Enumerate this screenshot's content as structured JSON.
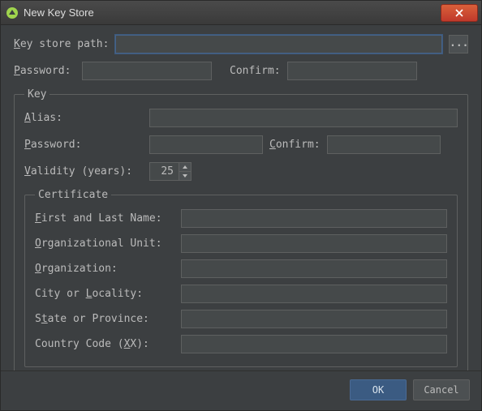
{
  "window": {
    "title": "New Key Store"
  },
  "path": {
    "label_pre": "K",
    "label_rest": "ey store path:",
    "value": "",
    "browse": "..."
  },
  "password": {
    "label_pre": "P",
    "label_rest": "assword:",
    "value": "",
    "confirm_label": "Confirm:",
    "confirm_value": ""
  },
  "key": {
    "legend": "Key",
    "alias": {
      "label_pre": "A",
      "label_rest": "lias:",
      "value": ""
    },
    "password": {
      "label_pre": "P",
      "label_rest": "assword:",
      "value": "",
      "confirm_label_pre": "C",
      "confirm_label_rest": "onfirm:",
      "confirm_value": ""
    },
    "validity": {
      "label_pre": "V",
      "label_rest": "alidity (years):",
      "value": "25"
    },
    "certificate": {
      "legend": "Certificate",
      "first_name": {
        "label_pre": "F",
        "label_rest": "irst and Last Name:",
        "value": ""
      },
      "org_unit": {
        "label_pre": "O",
        "label_rest": "rganizational Unit:",
        "value": ""
      },
      "org": {
        "label_pre": "O",
        "label_rest": "rganization:",
        "value": ""
      },
      "city": {
        "label": "City or ",
        "label_ul": "L",
        "label_post": "ocality:",
        "value": ""
      },
      "state": {
        "label": "S",
        "label_ul": "t",
        "label_post": "ate or Province:",
        "value": ""
      },
      "country": {
        "label": "Country Code (",
        "label_ul": "X",
        "label_post": "X):",
        "value": ""
      }
    }
  },
  "buttons": {
    "ok": "OK",
    "cancel": "Cancel"
  }
}
